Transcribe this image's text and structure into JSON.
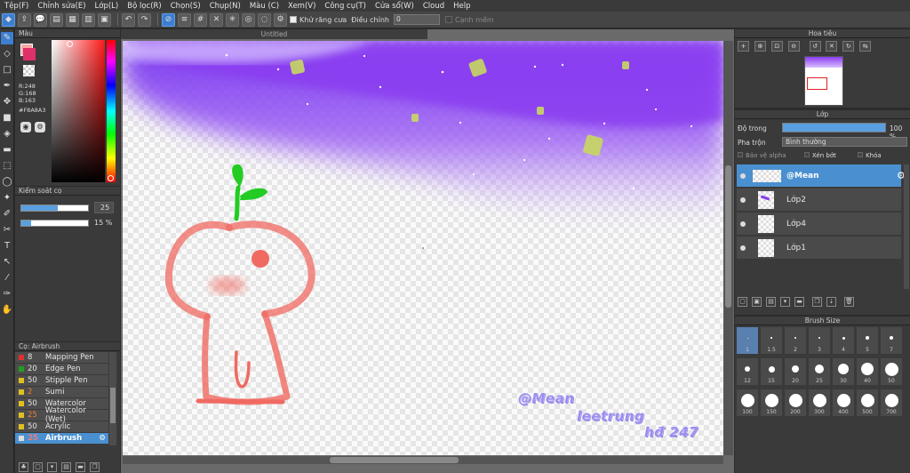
{
  "menu": [
    "Tệp(F)",
    "Chỉnh sửa(E)",
    "Lớp(L)",
    "Bộ lọc(R)",
    "Chọn(S)",
    "Chụp(N)",
    "Màu (C)",
    "Xem(V)",
    "Công cụ(T)",
    "Cửa sổ(W)",
    "Cloud",
    "Help"
  ],
  "toolbar": {
    "antialias_label": "Khử răng cưa",
    "correction_label": "Điều chỉnh",
    "correction_value": "0",
    "edge_label": "Cạnh mềm"
  },
  "color_panel": {
    "title": "Màu",
    "r": "R:248",
    "g": "G:168",
    "b": "B:163",
    "hex": "#F8A8A3"
  },
  "brush_control": {
    "title": "Kiểm soát cọ",
    "size_value": "25",
    "opacity_value": "15 %",
    "size_fraction": 0.55,
    "opacity_fraction": 0.15
  },
  "brush_list": {
    "title": "Cọ: Airbrush",
    "items": [
      {
        "num": "8",
        "name": "Mapping Pen",
        "color": "#e03030"
      },
      {
        "num": "20",
        "name": "Edge Pen",
        "color": "#20a020"
      },
      {
        "num": "50",
        "name": "Stipple Pen",
        "color": "#e0c020"
      },
      {
        "num": "2",
        "name": "Sumi",
        "color": "#e0c020"
      },
      {
        "num": "50",
        "name": "Watercolor",
        "color": "#e0c020"
      },
      {
        "num": "25",
        "name": "Watercolor (Wet)",
        "color": "#e0c020"
      },
      {
        "num": "50",
        "name": "Acrylic",
        "color": "#e0c020"
      },
      {
        "num": "25",
        "name": "Airbrush",
        "color": "#dddddd"
      }
    ]
  },
  "document": {
    "tab_title": "Untitled",
    "sig_line1": "@Mean",
    "sig_line2": "leetrung",
    "sig_line3": "hđ 247"
  },
  "navigator": {
    "title": "Hoa tiêu"
  },
  "layers_panel": {
    "title": "Lớp",
    "opacity_label": "Độ trong",
    "opacity_value": "100 %",
    "blend_label": "Pha trộn",
    "blend_value": "Bình thường",
    "protect_alpha": "Bảo vệ alpha",
    "clipping": "Xén bớt",
    "lock": "Khóa",
    "layers": [
      "@Mean",
      "Lớp2",
      "Lớp4",
      "Lớp1"
    ]
  },
  "brush_size_panel": {
    "title": "Brush Size",
    "sizes": [
      "1",
      "1.5",
      "2",
      "3",
      "4",
      "5",
      "7",
      "12",
      "15",
      "20",
      "25",
      "30",
      "40",
      "50",
      "100",
      "150",
      "200",
      "300",
      "400",
      "500",
      "700"
    ]
  },
  "colors": {
    "accent": "#4a90d0",
    "foreground": "#F8A8A3",
    "brush_stroke": "#f06a62",
    "leaf": "#22cc22",
    "sky": "#8a3cf0"
  }
}
